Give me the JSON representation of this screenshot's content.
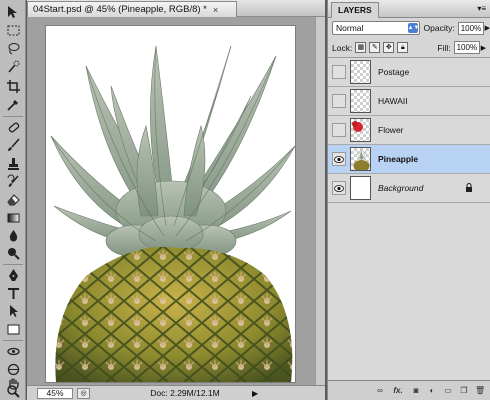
{
  "document": {
    "tab_title": "04Start.psd @ 45% (Pineapple, RGB/8) *",
    "close_glyph": "×",
    "zoom": "45%",
    "doc_size": "Doc: 2.29M/12.1M",
    "status_arrow": "▶"
  },
  "toolbox": {
    "tools": [
      "move-tool",
      "marquee-tool",
      "lasso-tool",
      "quick-selection-tool",
      "crop-tool",
      "eyedropper-tool",
      "healing-brush-tool",
      "brush-tool",
      "clone-stamp-tool",
      "history-brush-tool",
      "eraser-tool",
      "gradient-tool",
      "blur-tool",
      "dodge-tool",
      "pen-tool",
      "type-tool",
      "path-selection-tool",
      "rectangle-tool",
      "3d-rotate-tool",
      "3d-orbit-tool",
      "hand-tool",
      "zoom-tool"
    ]
  },
  "layers_panel": {
    "tab_label": "LAYERS",
    "menu_glyph": "▾≡",
    "blend_mode": "Normal",
    "opacity_label": "Opacity:",
    "opacity_value": "100%",
    "lock_label": "Lock:",
    "fill_label": "Fill:",
    "fill_value": "100%",
    "layers": [
      {
        "name": "Postage",
        "visible": false,
        "selected": false
      },
      {
        "name": "HAWAII",
        "visible": false,
        "selected": false
      },
      {
        "name": "Flower",
        "visible": false,
        "selected": false
      },
      {
        "name": "Pineapple",
        "visible": true,
        "selected": true
      },
      {
        "name": "Background",
        "visible": true,
        "selected": false,
        "locked": true
      }
    ],
    "footer_icons": [
      "link-layers-icon",
      "fx-icon",
      "add-mask-icon",
      "adjustment-layer-icon",
      "new-group-icon",
      "new-layer-icon",
      "delete-layer-icon"
    ],
    "fx_label": "fx."
  },
  "colors": {
    "selected_layer": "#b8d2f3",
    "panel_bg": "#d6d6d6"
  }
}
